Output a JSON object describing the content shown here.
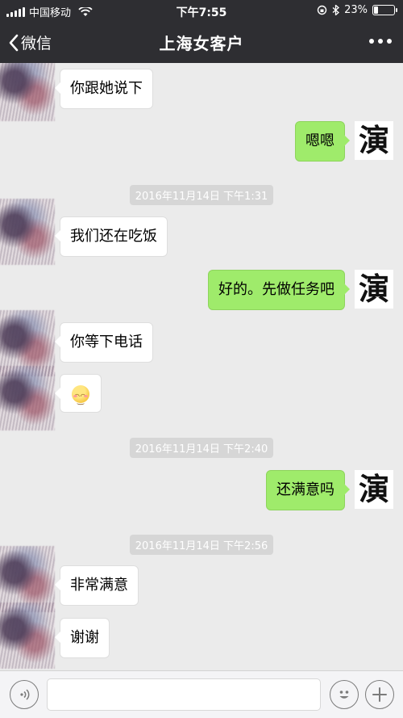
{
  "status": {
    "carrier": "中国移动",
    "time": "下午7:55",
    "battery": "23%",
    "battery_level": 0.23
  },
  "nav": {
    "back_label": "微信",
    "title": "上海女客户"
  },
  "messages": {
    "m1": "你跟她说下",
    "m2": "嗯嗯",
    "ts1": "2016年11月14日 下午1:31",
    "m3": "我们还在吃饭",
    "m4": "好的。先做任务吧",
    "m5": "你等下电话",
    "ts2": "2016年11月14日 下午2:40",
    "m7": "还满意吗",
    "ts3": "2016年11月14日 下午2:56",
    "m8": "非常满意",
    "m9": "谢谢"
  },
  "self_avatar_char": "演",
  "colors": {
    "out_bubble": "#9feb6b",
    "in_bubble": "#ffffff",
    "chat_bg": "#ebebeb",
    "topbar": "#2e2e32"
  },
  "icons": {
    "voice": "voice-icon",
    "emoji": "emoji-icon",
    "plus": "plus-icon"
  }
}
